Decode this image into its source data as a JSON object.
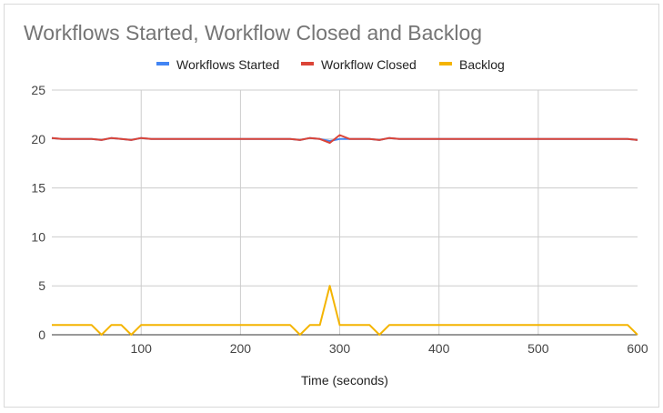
{
  "chart_data": {
    "type": "line",
    "title": "Workflows Started, Workflow Closed and Backlog",
    "xlabel": "Time (seconds)",
    "ylabel": "",
    "xlim": [
      10,
      600
    ],
    "ylim": [
      0,
      25
    ],
    "x_ticks": [
      100,
      200,
      300,
      400,
      500,
      600
    ],
    "y_ticks": [
      0,
      5,
      10,
      15,
      20,
      25
    ],
    "grid": true,
    "legend_position": "top",
    "x": [
      10,
      20,
      30,
      40,
      50,
      60,
      70,
      80,
      90,
      100,
      110,
      120,
      130,
      140,
      150,
      160,
      170,
      180,
      190,
      200,
      210,
      220,
      230,
      240,
      250,
      260,
      270,
      280,
      290,
      300,
      310,
      320,
      330,
      340,
      350,
      360,
      370,
      380,
      390,
      400,
      410,
      420,
      430,
      440,
      450,
      460,
      470,
      480,
      490,
      500,
      510,
      520,
      530,
      540,
      550,
      560,
      570,
      580,
      590,
      600
    ],
    "series": [
      {
        "name": "Workflows Started",
        "color": "#4285f4",
        "values": [
          20.1,
          20,
          20,
          20,
          20,
          19.9,
          20.1,
          20,
          19.9,
          20.1,
          20,
          20,
          20,
          20,
          20,
          20,
          20,
          20,
          20,
          20,
          20,
          20,
          20,
          20,
          20,
          19.9,
          20.1,
          20,
          19.8,
          20,
          20,
          20,
          20,
          19.9,
          20.1,
          20,
          20,
          20,
          20,
          20,
          20,
          20,
          20,
          20,
          20,
          20,
          20,
          20,
          20,
          20,
          20,
          20,
          20,
          20,
          20,
          20,
          20,
          20,
          20,
          19.9
        ]
      },
      {
        "name": "Workflow Closed",
        "color": "#db4437",
        "values": [
          20.1,
          20,
          20,
          20,
          20,
          19.9,
          20.1,
          20,
          19.9,
          20.1,
          20,
          20,
          20,
          20,
          20,
          20,
          20,
          20,
          20,
          20,
          20,
          20,
          20,
          20,
          20,
          19.9,
          20.1,
          20,
          19.6,
          20.4,
          20,
          20,
          20,
          19.9,
          20.1,
          20,
          20,
          20,
          20,
          20,
          20,
          20,
          20,
          20,
          20,
          20,
          20,
          20,
          20,
          20,
          20,
          20,
          20,
          20,
          20,
          20,
          20,
          20,
          20,
          19.9
        ]
      },
      {
        "name": "Backlog",
        "color": "#f4b400",
        "values": [
          1,
          1,
          1,
          1,
          1,
          0,
          1,
          1,
          0,
          1,
          1,
          1,
          1,
          1,
          1,
          1,
          1,
          1,
          1,
          1,
          1,
          1,
          1,
          1,
          1,
          0,
          1,
          1,
          5,
          1,
          1,
          1,
          1,
          0,
          1,
          1,
          1,
          1,
          1,
          1,
          1,
          1,
          1,
          1,
          1,
          1,
          1,
          1,
          1,
          1,
          1,
          1,
          1,
          1,
          1,
          1,
          1,
          1,
          1,
          0
        ]
      }
    ]
  }
}
